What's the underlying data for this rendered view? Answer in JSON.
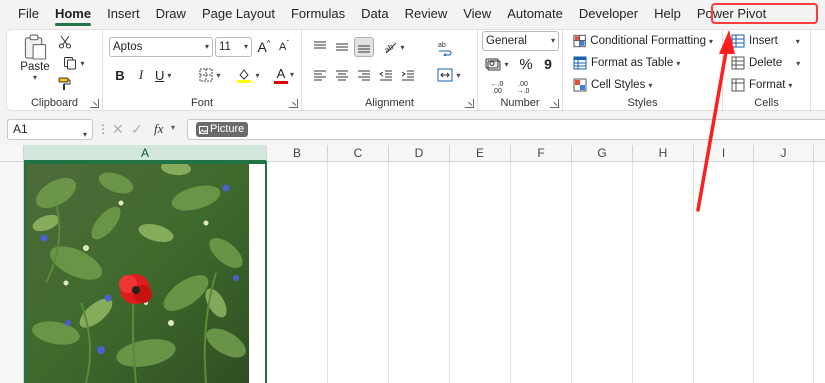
{
  "ribbon_tabs": [
    "File",
    "Home",
    "Insert",
    "Draw",
    "Page Layout",
    "Formulas",
    "Data",
    "Review",
    "View",
    "Automate",
    "Developer",
    "Help",
    "Power Pivot"
  ],
  "active_tab": "Home",
  "clipboard": {
    "paste_label": "Paste",
    "group_label": "Clipboard"
  },
  "font": {
    "name": "Aptos",
    "size": "11",
    "bold": "B",
    "italic": "I",
    "underline": "U",
    "grow": "A",
    "shrink": "A",
    "font_color_letter": "A",
    "group_label": "Font"
  },
  "alignment": {
    "group_label": "Alignment"
  },
  "number": {
    "format": "General",
    "percent": "%",
    "comma": "9",
    "increase_decimal": "←.0\n.00",
    "decrease_decimal": ".00\n→.0",
    "group_label": "Number"
  },
  "styles": {
    "conditional": "Conditional Formatting",
    "format_table": "Format as Table",
    "cell_styles": "Cell Styles",
    "group_label": "Styles"
  },
  "cells": {
    "insert": "Insert",
    "delete": "Delete",
    "format": "Format",
    "group_label": "Cells"
  },
  "formula_bar": {
    "name_box": "A1",
    "fx": "fx",
    "chip": "Picture"
  },
  "columns": [
    "A",
    "B",
    "C",
    "D",
    "E",
    "F",
    "G",
    "H",
    "I",
    "J"
  ],
  "selected_column": "A",
  "colors": {
    "accent_green": "#217346",
    "annotation_red": "#ff2a2a",
    "font_color_bar": "#e00000",
    "highlight_bar": "#ffff00"
  }
}
